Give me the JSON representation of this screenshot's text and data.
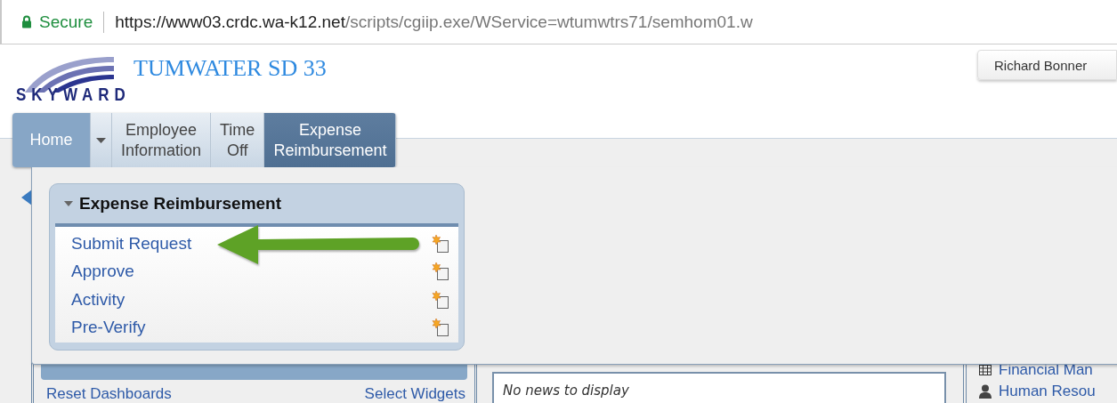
{
  "browser": {
    "security": "Secure",
    "url_host": "https://www03.crdc.wa-k12.net",
    "url_path": "/scripts/cgiip.exe/WService=wtumwtrs71/semhom01.w"
  },
  "header": {
    "logo": "SKYWARD",
    "district": "TUMWATER SD 33",
    "user": "Richard Bonner"
  },
  "nav_tabs": [
    {
      "kind": "home",
      "label": "Home",
      "selected": false
    },
    {
      "kind": "tab",
      "label": "Employee Information",
      "selected": false
    },
    {
      "kind": "tab",
      "label": "Time Off",
      "selected": false
    },
    {
      "kind": "tab",
      "label": "Expense Reimbursement",
      "selected": true
    }
  ],
  "dropdown": {
    "title": "Expense Reimbursement",
    "expanded": true,
    "items": [
      {
        "label": "Submit Request"
      },
      {
        "label": "Approve"
      },
      {
        "label": "Activity"
      },
      {
        "label": "Pre-Verify"
      }
    ]
  },
  "dashboard": {
    "links": [
      "Reset Dashboards",
      "Select Widgets"
    ],
    "news": "No news to display",
    "side_links": [
      "Financial Man",
      "Human Resou"
    ]
  }
}
